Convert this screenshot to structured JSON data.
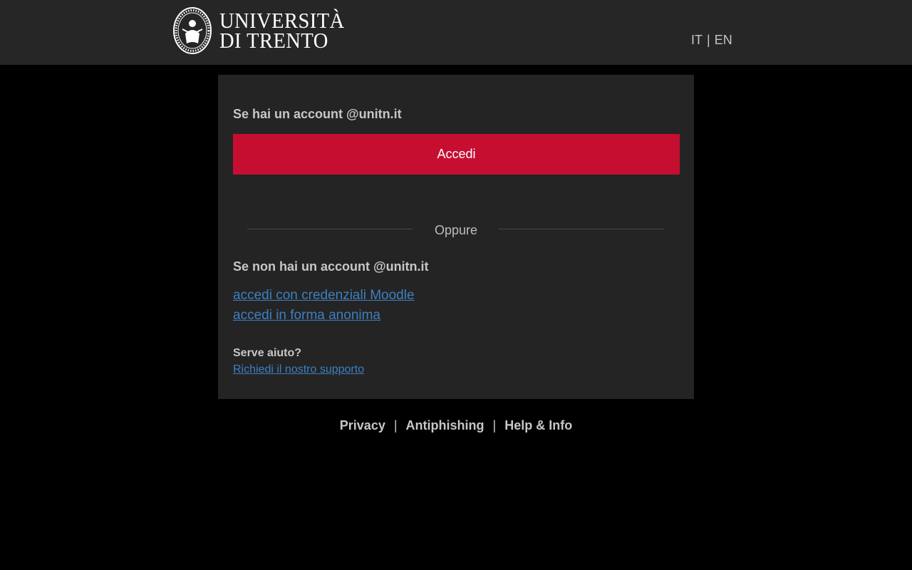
{
  "header": {
    "logo": {
      "line1": "UNIVERSITÀ",
      "line2": "DI TRENTO"
    },
    "languages": [
      "IT",
      "EN"
    ],
    "language_separator": "|"
  },
  "login": {
    "account_heading": "Se hai un account @unitn.it",
    "login_button": "Accedi",
    "divider_text": "Oppure",
    "no_account_heading": "Se non hai un account @unitn.it",
    "moodle_link": "accedi con credenziali Moodle",
    "anonymous_link": "accedi in forma anonima",
    "help_title": "Serve aiuto?",
    "support_link": "Richiedi il nostro supporto"
  },
  "footer": {
    "links": [
      "Privacy",
      "Antiphishing",
      "Help & Info"
    ],
    "separator": "|"
  },
  "colors": {
    "header_bg": "#262626",
    "page_bg": "#000000",
    "card_bg": "#242424",
    "primary_button": "#c60e31",
    "link": "#3d7fc1"
  }
}
